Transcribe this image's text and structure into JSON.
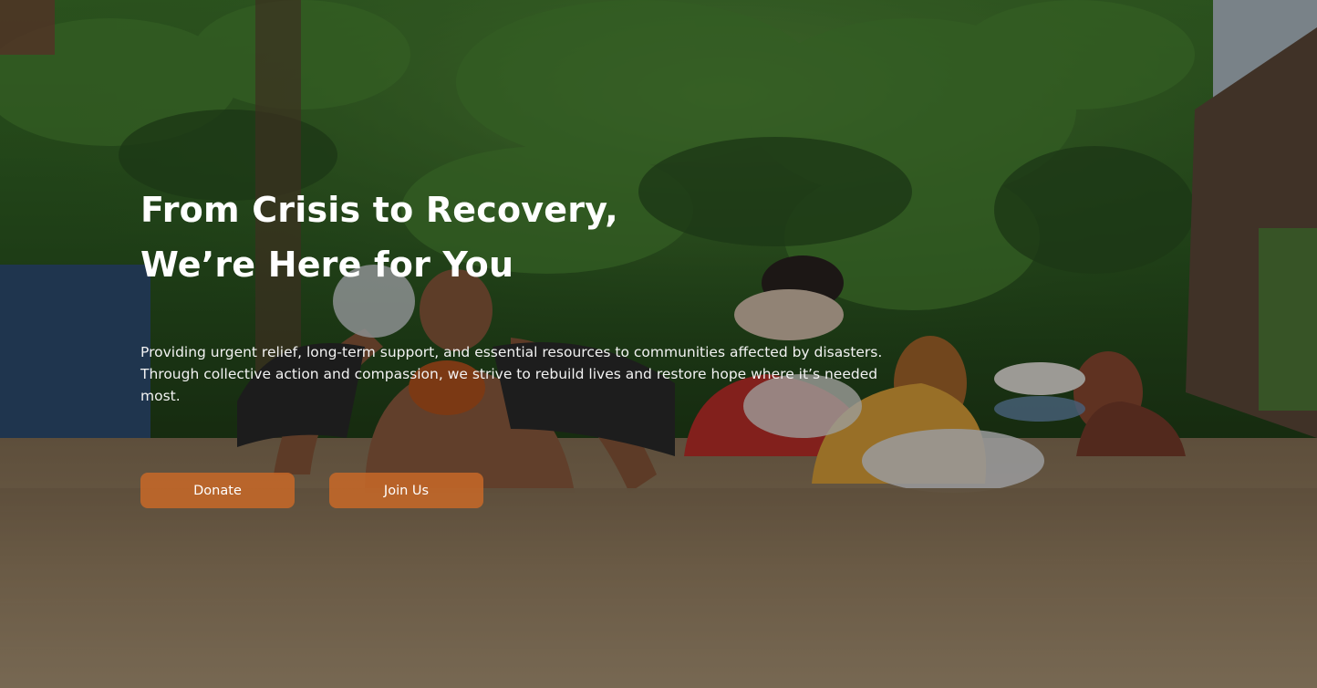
{
  "hero": {
    "title_line_1": "From Crisis to Recovery,",
    "title_line_2": "We’re Here for You",
    "description": "Providing urgent relief, long-term support, and essential resources to communities affected by disasters. Through collective action and compassion, we strive to rebuild lives and restore hope where it’s needed most.",
    "buttons": {
      "donate": "Donate",
      "join": "Join Us"
    }
  },
  "colors": {
    "button_bg": "#C86928",
    "text": "#FFFFFF",
    "overlay": "#000000"
  }
}
